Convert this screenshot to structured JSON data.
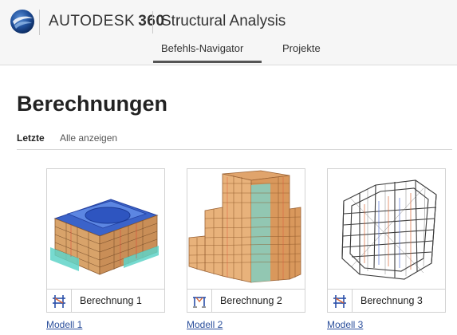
{
  "header": {
    "brand": "AUTODESK",
    "brand_version": "360",
    "product": "Structural Analysis"
  },
  "nav": {
    "tabs": [
      {
        "label": "Befehls-Navigator",
        "active": true
      },
      {
        "label": "Projekte",
        "active": false
      }
    ]
  },
  "page": {
    "title": "Berechnungen",
    "subtabs": [
      {
        "label": "Letzte",
        "active": true
      },
      {
        "label": "Alle anzeigen",
        "active": false
      }
    ]
  },
  "cards": [
    {
      "label": "Berechnung 1",
      "link": "Modell 1",
      "icon": "frame-structure-icon"
    },
    {
      "label": "Berechnung 2",
      "link": "Modell 2",
      "icon": "portal-frame-icon"
    },
    {
      "label": "Berechnung 3",
      "link": "Modell 3",
      "icon": "frame-structure-icon"
    }
  ],
  "colors": {
    "link": "#2b4f9c",
    "header_bg": "#f6f6f6",
    "active_underline": "#555555"
  }
}
